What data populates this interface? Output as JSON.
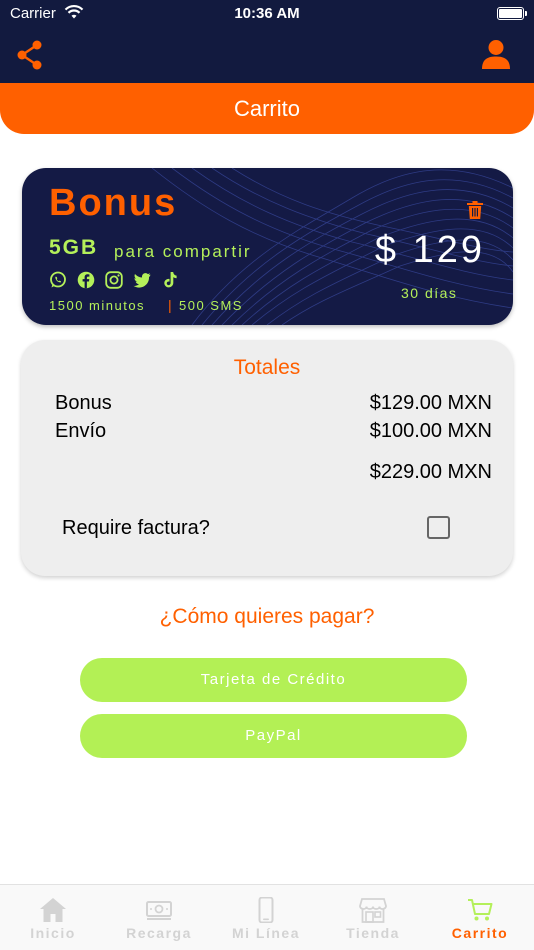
{
  "status_bar": {
    "carrier": "Carrier",
    "time": "10:36 AM"
  },
  "nav": {
    "share_icon": "share-icon",
    "user_icon": "user-icon"
  },
  "page": {
    "title": "Carrito"
  },
  "product": {
    "name": "Bonus",
    "data_amount": "5GB",
    "data_label": "para compartir",
    "social_icons": [
      "whatsapp-icon",
      "facebook-icon",
      "instagram-icon",
      "twitter-icon",
      "tiktok-icon"
    ],
    "minutes": "1500 minutos",
    "separator": "|",
    "sms": "500 SMS",
    "price": "$ 129",
    "period": "30 días"
  },
  "totals": {
    "title": "Totales",
    "items": [
      {
        "label": "Bonus",
        "value": "$129.00 MXN"
      },
      {
        "label": "Envío",
        "value": "$100.00 MXN"
      }
    ],
    "total": "$229.00 MXN",
    "invoice_label": "Require factura?",
    "invoice_checked": false
  },
  "payment": {
    "question": "¿Cómo quieres pagar?",
    "options": [
      "Tarjeta de Crédito",
      "PayPal"
    ]
  },
  "tabs": [
    {
      "label": "Inicio",
      "icon": "home-icon",
      "active": false
    },
    {
      "label": "Recarga",
      "icon": "money-icon",
      "active": false
    },
    {
      "label": "Mi Línea",
      "icon": "phone-icon",
      "active": false
    },
    {
      "label": "Tienda",
      "icon": "store-icon",
      "active": false
    },
    {
      "label": "Carrito",
      "icon": "cart-icon",
      "active": true
    }
  ],
  "colors": {
    "navy": "#121a3f",
    "orange": "#ff6000",
    "lime": "#b4f05a",
    "inactive_tab": "#d3d3d3"
  }
}
